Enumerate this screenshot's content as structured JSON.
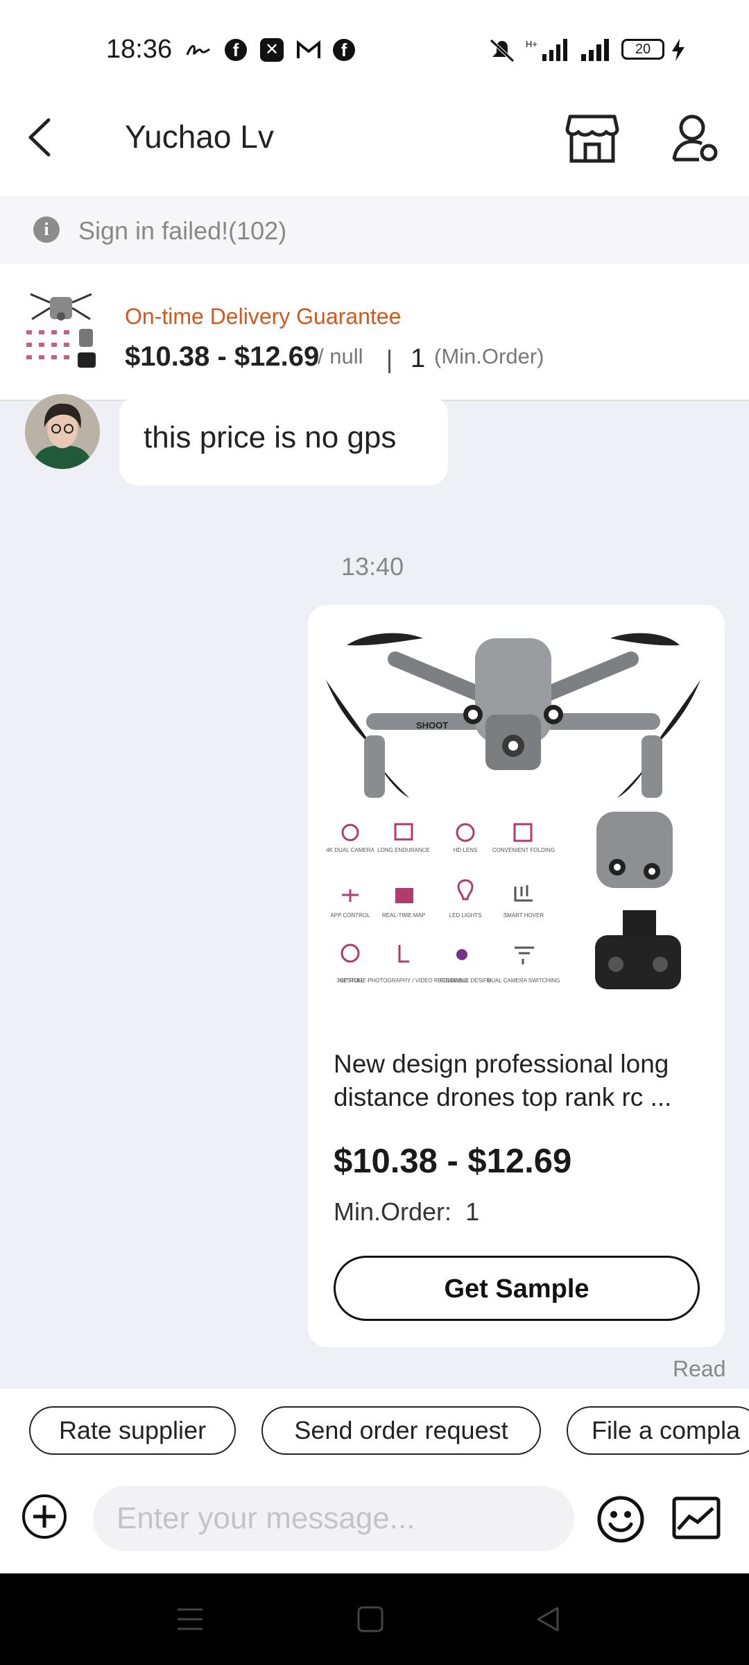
{
  "status_bar": {
    "time": "18:36",
    "battery": "20",
    "icons": [
      "signature-icon",
      "facebook-icon",
      "capcut-icon",
      "gmail-icon",
      "facebook-icon",
      "mute-icon",
      "signal-icon",
      "signal-icon",
      "charging-icon"
    ]
  },
  "header": {
    "contact_name": "Yuchao Lv",
    "icons": [
      "back-arrow-icon",
      "store-icon",
      "profile-settings-icon"
    ]
  },
  "banner": {
    "text": "Sign in failed!(102)",
    "icon": "info-icon"
  },
  "product_bar": {
    "delivery_label": "On-time Delivery Guarantee",
    "price_range": "$10.38 - $12.69",
    "unit": "/ null",
    "min_order_value": "1",
    "min_order_label": "(Min.Order)"
  },
  "chat": {
    "incoming_message": "this price is no gps",
    "timestamp": "13:40",
    "product_card": {
      "title": "New design professional long distance drones top rank rc ...",
      "price_range": "$10.38 - $12.69",
      "min_order_label": "Min.Order:",
      "min_order_value": "1",
      "button_label": "Get Sample",
      "feature_labels": [
        "4K DUAL CAMERA",
        "LONG ENDURANCE",
        "HD LENS",
        "CONVENIENT FOLDING",
        "APP CONTROL",
        "REAL-TIME MAP",
        "LED LIGHTS",
        "SMART HOVER",
        "360° ROLL",
        "GESTURE PHOTOGRAPHY / VIDEO RECORDING",
        "FOLDABLE DESIFN",
        "DUAL CAMERA SWITCHING"
      ],
      "drone_badge": "SHOOT"
    },
    "read_status": "Read"
  },
  "quick_actions": [
    "Rate supplier",
    "Send order request",
    "File a compla"
  ],
  "composer": {
    "placeholder": "Enter your message...",
    "icons": [
      "add-icon",
      "emoji-icon",
      "image-icon"
    ]
  },
  "colors": {
    "accent": "#d4571f",
    "background": "#eef0f5"
  }
}
